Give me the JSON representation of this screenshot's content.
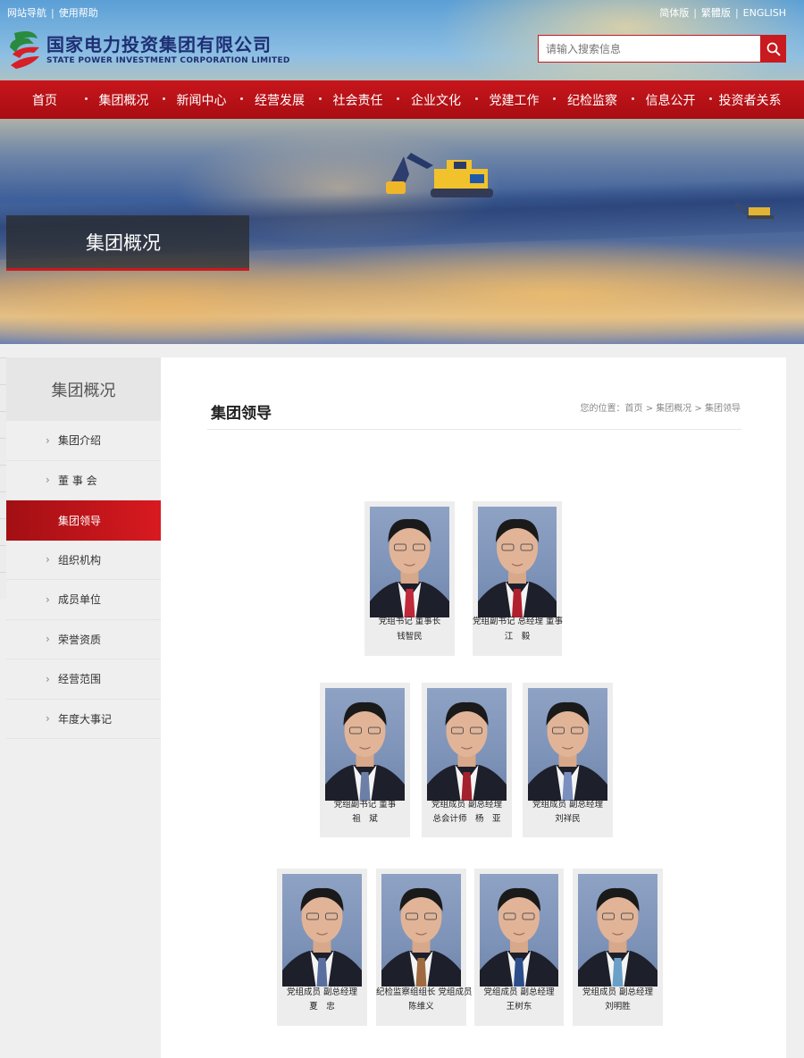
{
  "utility": {
    "left": [
      "网站导航",
      "使用帮助"
    ],
    "right": [
      "简体版",
      "繁體版",
      "ENGLISH"
    ]
  },
  "logo": {
    "cn": "国家电力投资集团有限公司",
    "en": "STATE POWER INVESTMENT CORPORATION LIMITED"
  },
  "search": {
    "placeholder": "请输入搜索信息"
  },
  "nav": [
    "首页",
    "集团概况",
    "新闻中心",
    "经营发展",
    "社会责任",
    "企业文化",
    "党建工作",
    "纪检监察",
    "信息公开",
    "投资者关系"
  ],
  "banner": {
    "title": "集团概况"
  },
  "sidebar": {
    "title": "集团概况",
    "items": [
      "集团介绍",
      "董 事 会",
      "集团领导",
      "组织机构",
      "成员单位",
      "荣誉资质",
      "经营范围",
      "年度大事记"
    ],
    "active_index": 2
  },
  "main": {
    "title": "集团领导",
    "breadcrumb": "您的位置：首页 > 集团概况 > 集团领导"
  },
  "leaders": [
    {
      "line1": "党组书记 董事长",
      "line2": "钱智民",
      "tie": "#c0293a"
    },
    {
      "line1": "党组副书记 总经理 董事",
      "line2": "江　毅",
      "tie": "#b0202e"
    },
    {
      "line1": "党组副书记 董事",
      "line2": "祖　斌",
      "tie": "#6c7fa6"
    },
    {
      "line1": "党组成员 副总经理",
      "line2": "总会计师　杨　亚",
      "tie": "#a3222d"
    },
    {
      "line1": "党组成员 副总经理",
      "line2": "刘祥民",
      "tie": "#7a8fbf"
    },
    {
      "line1": "党组成员 副总经理",
      "line2": "夏　忠",
      "tie": "#5a6fa0"
    },
    {
      "line1": "纪检监察组组长 党组成员",
      "line2": "陈维义",
      "tie": "#a06a40"
    },
    {
      "line1": "党组成员 副总经理",
      "line2": "王树东",
      "tie": "#2c4f8c"
    },
    {
      "line1": "党组成员 副总经理",
      "line2": "刘明胜",
      "tie": "#6aa0c8"
    }
  ],
  "colors": {
    "brand_red": "#c81a1f",
    "navy": "#1f2f74"
  }
}
